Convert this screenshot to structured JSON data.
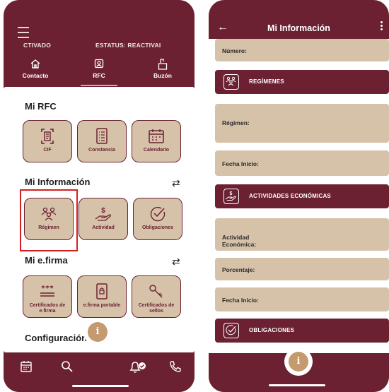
{
  "left": {
    "status": {
      "activado": "CTIVADO",
      "estatus": "ESTATUS: REACTIVAI"
    },
    "tabs": [
      {
        "label": "Contacto",
        "icon": "home-icon"
      },
      {
        "label": "RFC",
        "icon": "id-card-icon",
        "active": true
      },
      {
        "label": "Buzón",
        "icon": "mailbox-icon"
      }
    ],
    "sections": {
      "mi_rfc": {
        "title": "Mi RFC",
        "tiles": [
          {
            "label": "CIF",
            "icon": "scan-document-icon"
          },
          {
            "label": "Constancia",
            "icon": "list-document-icon"
          },
          {
            "label": "Calendario",
            "icon": "calendar-icon"
          }
        ]
      },
      "mi_informacion": {
        "title": "Mi Información",
        "tiles": [
          {
            "label": "Régimen",
            "icon": "people-group-icon"
          },
          {
            "label": "Actividad",
            "icon": "hand-money-icon"
          },
          {
            "label": "Obligaciones",
            "icon": "checkmark-circle-icon"
          }
        ]
      },
      "mi_efirma": {
        "title": "Mi e.firma",
        "tiles": [
          {
            "label": "Certificados de e.firma",
            "icon": "password-field-icon"
          },
          {
            "label": "e.firma portable",
            "icon": "lock-device-icon"
          },
          {
            "label": "Certificados de sellos",
            "icon": "key-icon"
          }
        ]
      },
      "configuracion": {
        "title": "Configuración"
      }
    },
    "bottom_bar": {
      "fab_label": "i",
      "icons": [
        "calendar-icon",
        "search-icon",
        "bell-check-icon",
        "phone-icon"
      ]
    }
  },
  "right": {
    "title": "Mi Información",
    "fields": {
      "numero": "Número:",
      "regimen": "Régimen:",
      "fecha_inicio_1": "Fecha Inicio:",
      "actividad": "Actividad\nEconómica:",
      "porcentaje": "Porcentaje:",
      "fecha_inicio_2": "Fecha Inicio:"
    },
    "sections": {
      "regimenes": "REGÍMENES",
      "actividades": "ACTIVIDADES ECONÓMICAS",
      "obligaciones": "OBLIGACIONES"
    },
    "fab_label": "i"
  },
  "colors": {
    "brand": "#6b2131",
    "tile": "#d6c2a9",
    "accent": "#c49a6e",
    "highlight": "#d61f1f"
  }
}
